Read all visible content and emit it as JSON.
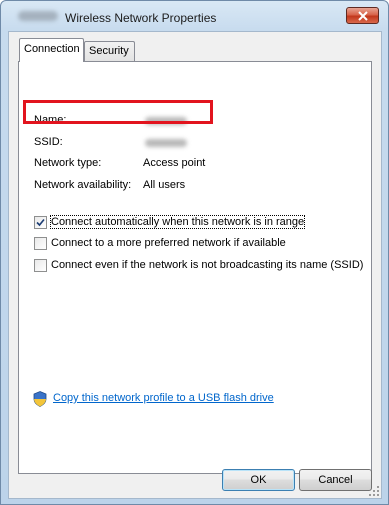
{
  "window": {
    "title": "Wireless Network Properties",
    "close_icon": "close-icon"
  },
  "tabs": [
    {
      "label": "Connection",
      "active": true
    },
    {
      "label": "Security",
      "active": false
    }
  ],
  "details": {
    "name_label": "Name:",
    "ssid_label": "SSID:",
    "network_type_label": "Network type:",
    "network_type_value": "Access point",
    "availability_label": "Network availability:",
    "availability_value": "All users"
  },
  "options": [
    {
      "label": "Connect automatically when this network is in range",
      "checked": true
    },
    {
      "label": "Connect to a more preferred network if available",
      "checked": false
    },
    {
      "label": "Connect even if the network is not broadcasting its name (SSID)",
      "checked": false
    }
  ],
  "link": {
    "label": "Copy this network profile to a USB flash drive",
    "icon": "shield-icon"
  },
  "buttons": {
    "ok": "OK",
    "cancel": "Cancel"
  },
  "colors": {
    "highlight": "#e2141e",
    "link": "#0066cc"
  }
}
